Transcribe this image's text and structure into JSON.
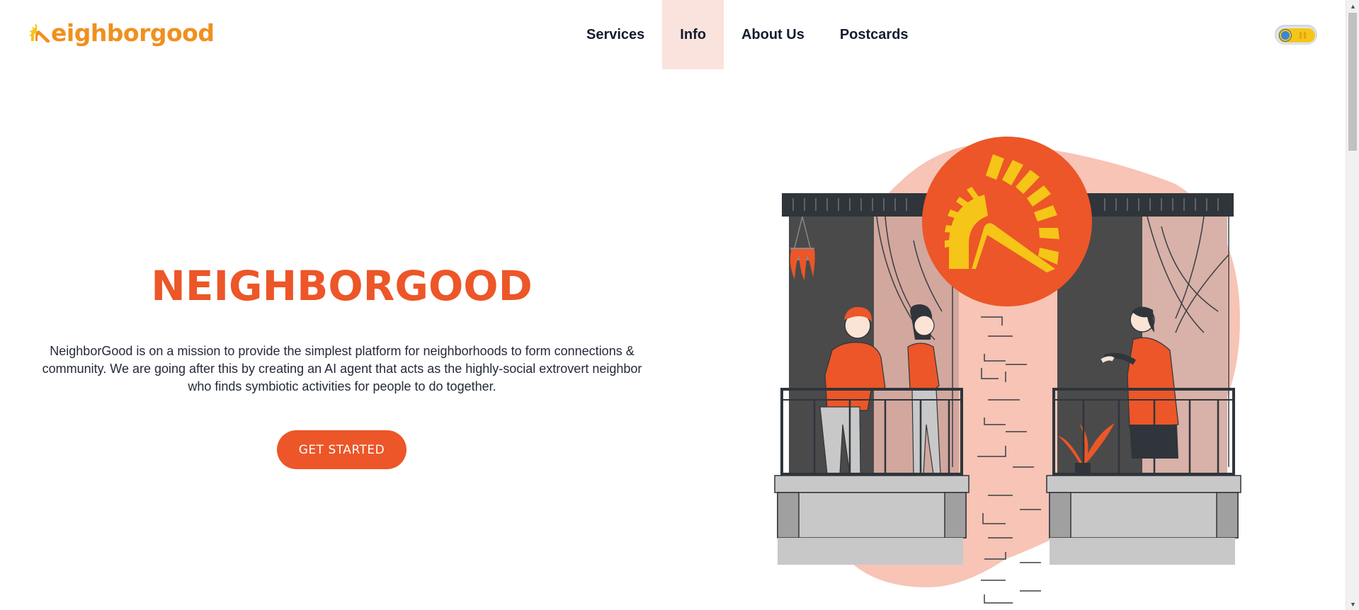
{
  "header": {
    "logo_text": "eighborgood",
    "nav": [
      {
        "label": "Services",
        "active": false
      },
      {
        "label": "Info",
        "active": true
      },
      {
        "label": "About Us",
        "active": false
      },
      {
        "label": "Postcards",
        "active": false
      }
    ],
    "theme_toggle_icon": "sun-icon"
  },
  "hero": {
    "title": "NEIGHBORGOOD",
    "description": "NeighborGood is on a mission to provide the simplest platform for neighborhoods to form connections & community. We are going after this by creating an AI agent that acts as the highly-social extrovert neighbor who finds symbiotic activities for people to do together.",
    "cta_label": "GET STARTED"
  },
  "colors": {
    "brand_orange": "#ec5628",
    "logo_orange": "#f0901e",
    "brand_yellow": "#f5c518",
    "blob_pink": "#f7c4b6",
    "dark_wall": "#4a4a4a",
    "nav_active_bg": "#f9e3dc"
  },
  "illustration": {
    "icon": "neighbors-on-balconies-illustration"
  }
}
